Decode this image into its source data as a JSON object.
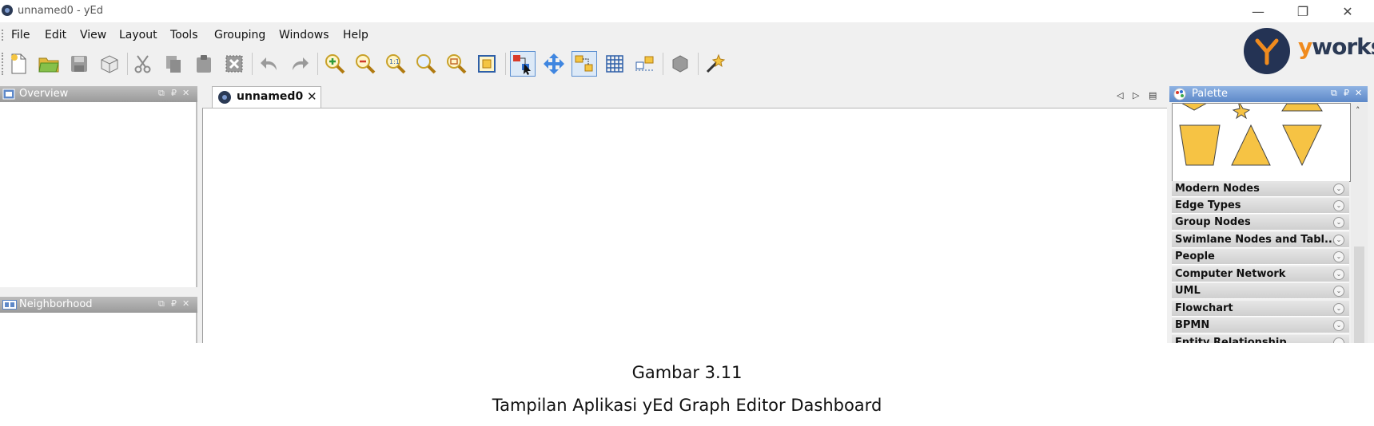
{
  "window": {
    "title": "unnamed0 - yEd",
    "controls": {
      "minimize": "—",
      "restore": "❐",
      "close": "✕"
    }
  },
  "menu": [
    "File",
    "Edit",
    "View",
    "Layout",
    "Tools",
    "Grouping",
    "Windows",
    "Help"
  ],
  "toolbar": {
    "buttons": [
      "new-document",
      "open",
      "save",
      "export",
      "cut",
      "copy",
      "paste",
      "delete",
      "undo",
      "redo",
      "zoom-in",
      "zoom-out",
      "zoom-original",
      "zoom-fit",
      "zoom-area",
      "fit-content",
      "edit-mode",
      "navigation-mode",
      "selection-mode",
      "grid",
      "snap-lines",
      "properties",
      "tip-of-the-day"
    ],
    "toggled": [
      "edit-mode",
      "selection-mode"
    ]
  },
  "logo": {
    "prefix": "y",
    "word": "works"
  },
  "overview_panel": {
    "title": "Overview"
  },
  "neighborhood_panel": {
    "title": "Neighborhood"
  },
  "document_tab": {
    "label": "unnamed0",
    "close": "✕"
  },
  "tab_nav": {
    "left": "◁",
    "right": "▷",
    "list": "▤"
  },
  "palette": {
    "title": "Palette",
    "categories": [
      "Modern Nodes",
      "Edge Types",
      "Group Nodes",
      "Swimlane Nodes and Tabl...",
      "People",
      "Computer Network",
      "UML",
      "Flowchart",
      "BPMN",
      "Entity Relationship"
    ],
    "shape_color": "#f6c344"
  },
  "caption": {
    "figure": "Gambar 3.11",
    "text": "Tampilan Aplikasi yEd Graph Editor Dashboard"
  }
}
